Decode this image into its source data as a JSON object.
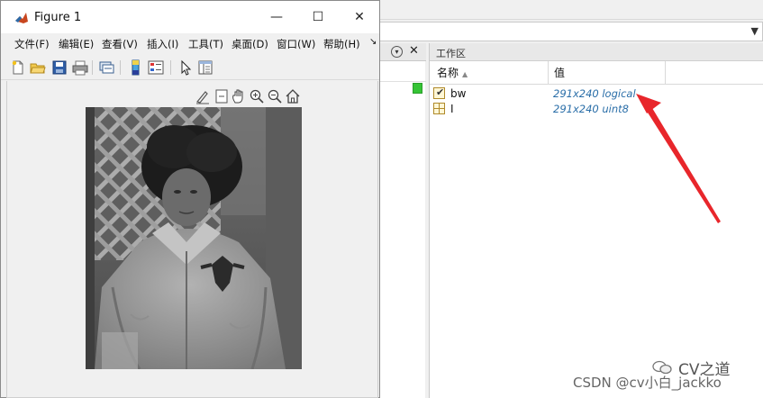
{
  "figure": {
    "title": "Figure 1",
    "menu": [
      "文件(F)",
      "编辑(E)",
      "查看(V)",
      "插入(I)",
      "工具(T)",
      "桌面(D)",
      "窗口(W)",
      "帮助(H)"
    ],
    "menu_overflow": "↘",
    "window_buttons": {
      "minimize": "—",
      "maximize": "☐",
      "close": "✕"
    }
  },
  "workspace": {
    "title": "工作区",
    "columns": {
      "name": "名称",
      "value": "值"
    },
    "rows": [
      {
        "name": "bw",
        "value": "291x240 logical",
        "icon": "logical-check-icon"
      },
      {
        "name": "I",
        "value": "291x240 uint8",
        "icon": "matrix-grid-icon"
      }
    ]
  },
  "panel": {
    "close": "✕",
    "dropdown": "▾"
  },
  "watermark": {
    "brand": "CV之道",
    "credit": "CSDN @cv小白_jackko"
  },
  "colors": {
    "accent_value": "#2a6ea8",
    "arrow": "#e8262b"
  }
}
